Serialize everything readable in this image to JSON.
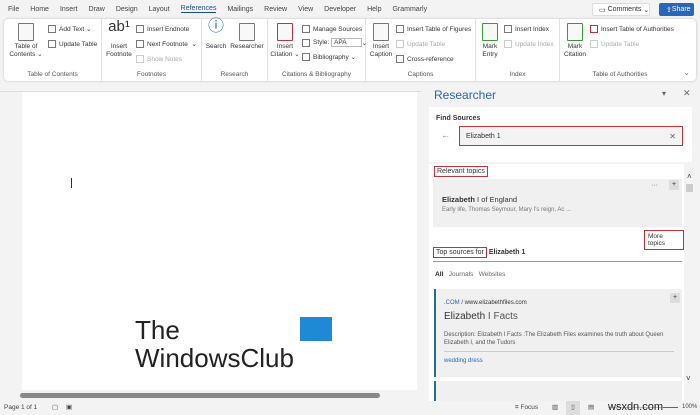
{
  "tabs": [
    "File",
    "Home",
    "Insert",
    "Draw",
    "Design",
    "Layout",
    "References",
    "Mailings",
    "Review",
    "View",
    "Developer",
    "Help",
    "Grammarly"
  ],
  "active_tab": "References",
  "comments_label": "Comments",
  "share_label": "Share",
  "ribbon": {
    "toc": {
      "big": "Table of Contents",
      "add_text": "Add Text",
      "update_table": "Update Table",
      "label": "Table of Contents"
    },
    "footnotes": {
      "big": "Insert Footnote",
      "insert_endnote": "Insert Endnote",
      "next_footnote": "Next Footnote",
      "show_notes": "Show Notes",
      "label": "Footnotes"
    },
    "research": {
      "search": "Search",
      "researcher": "Researcher",
      "label": "Research"
    },
    "citations": {
      "big": "Insert Citation",
      "manage": "Manage Sources",
      "style_label": "Style:",
      "style_value": "APA",
      "bibliography": "Bibliography",
      "label": "Citations & Bibliography"
    },
    "captions": {
      "big": "Insert Caption",
      "table_of_figures": "Insert Table of Figures",
      "update_table": "Update Table",
      "cross_ref": "Cross-reference",
      "label": "Captions"
    },
    "index": {
      "big": "Mark Entry",
      "insert_index": "Insert Index",
      "update_index": "Update Index",
      "label": "Index"
    },
    "authorities": {
      "big": "Mark Citation",
      "insert": "Insert Table of Authorities",
      "update": "Update Table",
      "label": "Table of Authorities"
    }
  },
  "watermark": {
    "line1": "The",
    "line2": "WindowsClub"
  },
  "researcher": {
    "title": "Researcher",
    "find_sources": "Find Sources",
    "query": "Elizabeth 1",
    "relevant_topics": "Relevant topics",
    "topic": {
      "bold": "Elizabeth",
      "rest": " I of England",
      "desc": "Early life, Thomas Seymour, Mary I's reign, Ac ..."
    },
    "more_topics": "More topics",
    "top_sources_prefix": "Top sources for",
    "top_sources_query": "Elizabeth 1",
    "filters": [
      "All",
      "Journals",
      "Websites"
    ],
    "source": {
      "domain_prefix": ".COM",
      "domain": " / www.elizabethfiles.com",
      "title_bold": "Elizabeth",
      "title_rest": " I Facts",
      "desc": "Description: Elizabeth I Facts :The Elizabeth Files examines the truth about Queen Elizabeth I, and the Tudors",
      "tag": "wedding dress"
    }
  },
  "status": {
    "page": "Page 1 of 1",
    "focus": "Focus",
    "zoom": "100%"
  },
  "watermark_site": "wsxdn.com"
}
